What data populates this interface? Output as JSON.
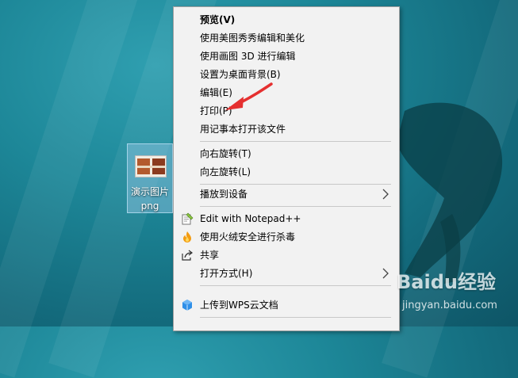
{
  "desktop": {
    "file": {
      "name_line1": "演示图片",
      "name_line2": "png"
    }
  },
  "context_menu": {
    "items": [
      {
        "label": "预览(V)",
        "bold": true
      },
      {
        "label": "使用美图秀秀编辑和美化"
      },
      {
        "label": "使用画图 3D 进行编辑"
      },
      {
        "label": "设置为桌面背景(B)"
      },
      {
        "label": "编辑(E)"
      },
      {
        "label": "打印(P)"
      },
      {
        "label": "用记事本打开该文件"
      },
      {
        "label": "向右旋转(T)"
      },
      {
        "label": "向左旋转(L)"
      },
      {
        "label": "播放到设备",
        "submenu": true
      },
      {
        "label": "Edit with Notepad++",
        "icon": "notepad-plus-plus-icon"
      },
      {
        "label": "使用火绒安全进行杀毒",
        "icon": "huorong-security-icon"
      },
      {
        "label": "共享",
        "icon": "share-icon"
      },
      {
        "label": "打开方式(H)",
        "submenu": true
      },
      {
        "label": "上传到WPS云文档",
        "icon": "wps-cloud-icon"
      }
    ]
  },
  "watermark": {
    "text": "Baidu经验",
    "subtext": "jingyan.baidu.com"
  },
  "colors": {
    "menu_bg": "#f2f2f2",
    "annotation_arrow": "#e53030",
    "desktop_water": "#1d8798"
  }
}
